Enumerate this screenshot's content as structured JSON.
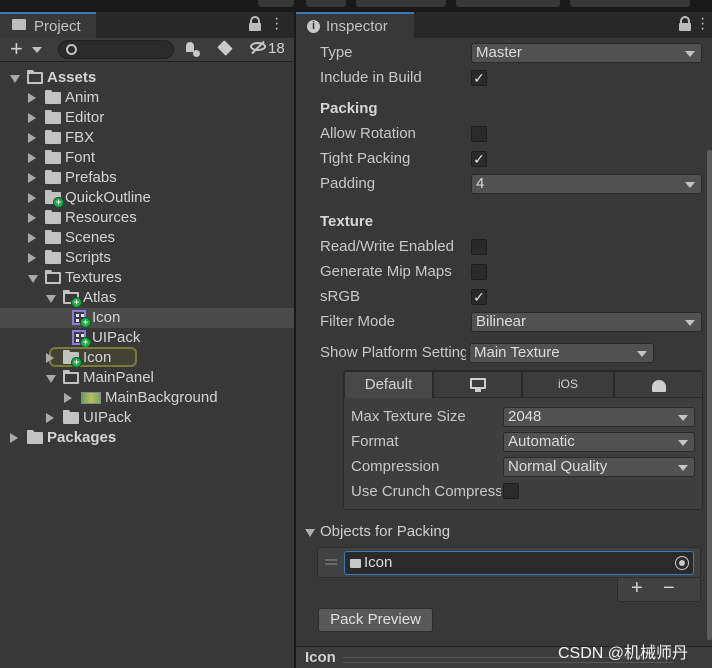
{
  "project": {
    "tab_title": "Project",
    "hidden_count": "18",
    "tree": [
      {
        "label": "Assets",
        "indent": 0,
        "expanded": true,
        "bold": true,
        "type": "folder"
      },
      {
        "label": "Anim",
        "indent": 1,
        "expanded": false,
        "type": "folder"
      },
      {
        "label": "Editor",
        "indent": 1,
        "expanded": false,
        "type": "folder"
      },
      {
        "label": "FBX",
        "indent": 1,
        "expanded": false,
        "type": "folder"
      },
      {
        "label": "Font",
        "indent": 1,
        "expanded": false,
        "type": "folder"
      },
      {
        "label": "Prefabs",
        "indent": 1,
        "expanded": false,
        "type": "folder"
      },
      {
        "label": "QuickOutline",
        "indent": 1,
        "expanded": false,
        "type": "folder",
        "badge": true
      },
      {
        "label": "Resources",
        "indent": 1,
        "expanded": false,
        "type": "folder"
      },
      {
        "label": "Scenes",
        "indent": 1,
        "expanded": false,
        "type": "folder"
      },
      {
        "label": "Scripts",
        "indent": 1,
        "expanded": false,
        "type": "folder"
      },
      {
        "label": "Textures",
        "indent": 1,
        "expanded": true,
        "type": "folder"
      },
      {
        "label": "Atlas",
        "indent": 2,
        "expanded": true,
        "type": "folder",
        "badge": true
      },
      {
        "label": "Icon",
        "indent": 3,
        "type": "sprite",
        "badge": true,
        "selected": true
      },
      {
        "label": "UIPack",
        "indent": 3,
        "type": "sprite",
        "badge": true
      },
      {
        "label": "Icon",
        "indent": 2,
        "expanded": false,
        "type": "folder",
        "badge": true,
        "highlight": true
      },
      {
        "label": "MainPanel",
        "indent": 2,
        "expanded": true,
        "type": "folder"
      },
      {
        "label": "MainBackground",
        "indent": 3,
        "expanded": false,
        "type": "image"
      },
      {
        "label": "UIPack",
        "indent": 2,
        "expanded": false,
        "type": "folder"
      },
      {
        "label": "Packages",
        "indent": 0,
        "expanded": false,
        "bold": true,
        "type": "folder"
      }
    ]
  },
  "inspector": {
    "tab_title": "Inspector",
    "type_label": "Type",
    "type_value": "Master",
    "include_label": "Include in Build",
    "include_checked": true,
    "packing_header": "Packing",
    "allow_rotation_label": "Allow Rotation",
    "allow_rotation_checked": false,
    "tight_packing_label": "Tight Packing",
    "tight_packing_checked": true,
    "padding_label": "Padding",
    "padding_value": "4",
    "texture_header": "Texture",
    "rw_label": "Read/Write Enabled",
    "rw_checked": false,
    "mip_label": "Generate Mip Maps",
    "mip_checked": false,
    "srgb_label": "sRGB",
    "srgb_checked": true,
    "filter_label": "Filter Mode",
    "filter_value": "Bilinear",
    "platform_label": "Show Platform Settings For",
    "platform_value": "Main Texture",
    "platform_tabs": {
      "default": "Default",
      "ios": "iOS"
    },
    "max_size_label": "Max Texture Size",
    "max_size_value": "2048",
    "format_label": "Format",
    "format_value": "Automatic",
    "compression_label": "Compression",
    "compression_value": "Normal Quality",
    "crunch_label": "Use Crunch Compression",
    "crunch_checked": false,
    "objects_header": "Objects for Packing",
    "object_item": "Icon",
    "add_symbol": "+",
    "remove_symbol": "−",
    "pack_preview_label": "Pack Preview",
    "footer_title": "Icon"
  },
  "watermark": "CSDN @机械师丹",
  "colors": {
    "accent": "#3a79bb",
    "selected_row": "#4b4b4b",
    "badge": "#22a94a",
    "sprite": "#8e7bd8"
  }
}
